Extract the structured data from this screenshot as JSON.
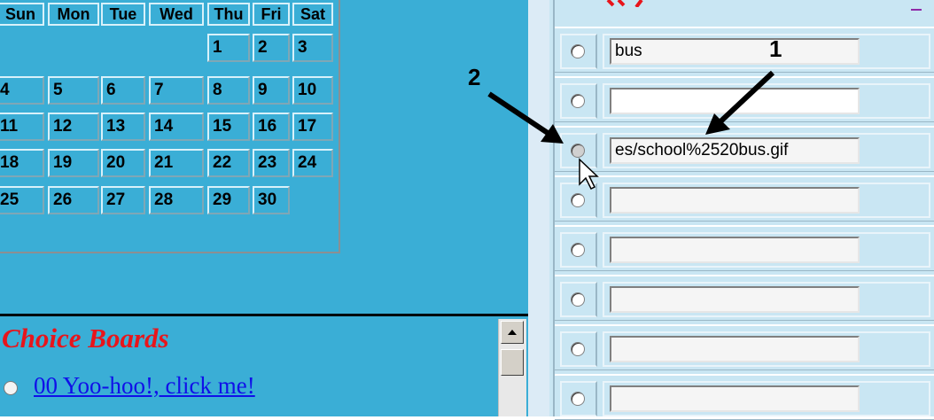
{
  "calendar": {
    "days": [
      "Sun",
      "Mon",
      "Tue",
      "Wed",
      "Thu",
      "Fri",
      "Sat"
    ],
    "weeks": [
      [
        "",
        "",
        "",
        "",
        "1",
        "2",
        "3"
      ],
      [
        "4",
        "5",
        "6",
        "7",
        "8",
        "9",
        "10"
      ],
      [
        "11",
        "12",
        "13",
        "14",
        "15",
        "16",
        "17"
      ],
      [
        "18",
        "19",
        "20",
        "21",
        "22",
        "23",
        "24"
      ],
      [
        "25",
        "26",
        "27",
        "28",
        "29",
        "30",
        ""
      ]
    ]
  },
  "choice_boards": {
    "title": "Choice Boards",
    "link": "00 Yoo-hoo!, click me!"
  },
  "picture_fields": [
    {
      "value": "bus"
    },
    {
      "value": ""
    },
    {
      "value": "es/school%2520bus.gif"
    },
    {
      "value": ""
    },
    {
      "value": ""
    },
    {
      "value": ""
    },
    {
      "value": ""
    },
    {
      "value": ""
    }
  ],
  "annotations": {
    "label_1": "1",
    "label_2": "2"
  },
  "colors": {
    "panel_blue": "#3aaed6",
    "title_red": "#e8151b",
    "link_blue": "#1010e8"
  }
}
